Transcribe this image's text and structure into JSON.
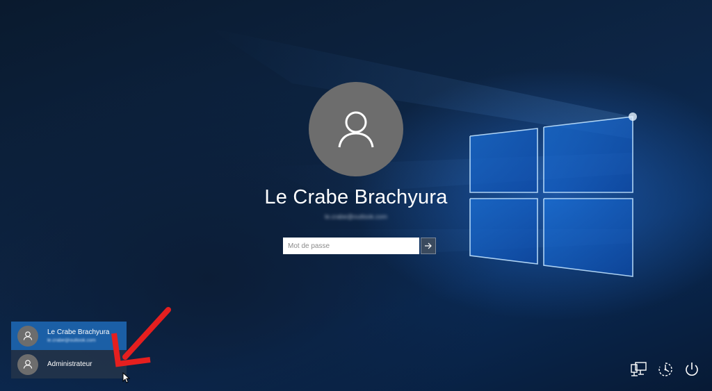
{
  "lock_screen": {
    "username": "Le Crabe Brachyura",
    "email": "le.crabe@outlook.com"
  },
  "password": {
    "placeholder": "Mot de passe",
    "value": ""
  },
  "user_list": [
    {
      "name": "Le Crabe Brachyura",
      "sub": "le.crabe@outlook.com",
      "selected": true
    },
    {
      "name": "Administrateur",
      "selected": false
    }
  ],
  "icons": {
    "avatar": "user-icon",
    "submit": "arrow-right-icon",
    "network": "network-icon",
    "ease_of_access": "ease-of-access-icon",
    "power": "power-icon"
  },
  "colors": {
    "selected_user": "#1b5fa6",
    "avatar_bg": "#6d6d6d",
    "annotation_arrow": "#e51f1f"
  }
}
